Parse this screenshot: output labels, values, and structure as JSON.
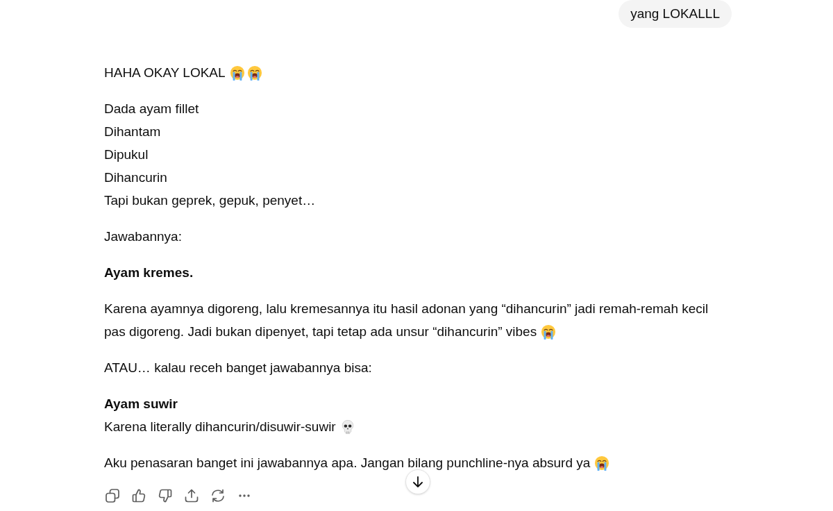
{
  "user_message": {
    "text": "yang LOKALLL"
  },
  "response": {
    "paragraphs": [
      {
        "lines": [
          {
            "text": "HAHA OKAY LOKAL",
            "bold": false,
            "emojis": [
              {
                "kind": "crying"
              },
              {
                "kind": "crying"
              }
            ]
          }
        ]
      },
      {
        "lines": [
          {
            "text": "Dada ayam fillet",
            "bold": false
          },
          {
            "text": "Dihantam",
            "bold": false
          },
          {
            "text": "Dipukul",
            "bold": false
          },
          {
            "text": "Dihancurin",
            "bold": false
          },
          {
            "text": "Tapi bukan geprek, gepuk, penyet…",
            "bold": false
          }
        ]
      },
      {
        "lines": [
          {
            "text": "Jawabannya:",
            "bold": false
          }
        ]
      },
      {
        "lines": [
          {
            "text": "Ayam kremes.",
            "bold": true
          }
        ]
      },
      {
        "lines": [
          {
            "text": "Karena ayamnya digoreng, lalu kremesannya itu hasil adonan yang “dihancurin” jadi remah-remah kecil",
            "bold": false
          },
          {
            "text": "pas digoreng. Jadi bukan dipenyet, tapi tetap ada unsur “dihancurin” vibes",
            "bold": false,
            "emojis": [
              {
                "kind": "crying"
              }
            ]
          }
        ]
      },
      {
        "lines": [
          {
            "text": "ATAU… kalau receh banget jawabannya bisa:",
            "bold": false
          }
        ]
      },
      {
        "lines": [
          {
            "text": "Ayam suwir",
            "bold": true
          },
          {
            "text": "Karena literally dihancurin/disuwir-suwir",
            "bold": false,
            "emojis": [
              {
                "kind": "skull"
              }
            ]
          }
        ]
      },
      {
        "lines": [
          {
            "text": "Aku penasaran banget ini jawabannya apa. Jangan bilang punchline-nya absurd ya",
            "bold": false,
            "emojis": [
              {
                "kind": "crying"
              }
            ]
          }
        ]
      }
    ]
  },
  "actions": [
    {
      "kind": "copy"
    },
    {
      "kind": "thumbs_up"
    },
    {
      "kind": "thumbs_down"
    },
    {
      "kind": "share"
    },
    {
      "kind": "regenerate"
    },
    {
      "kind": "more"
    }
  ]
}
